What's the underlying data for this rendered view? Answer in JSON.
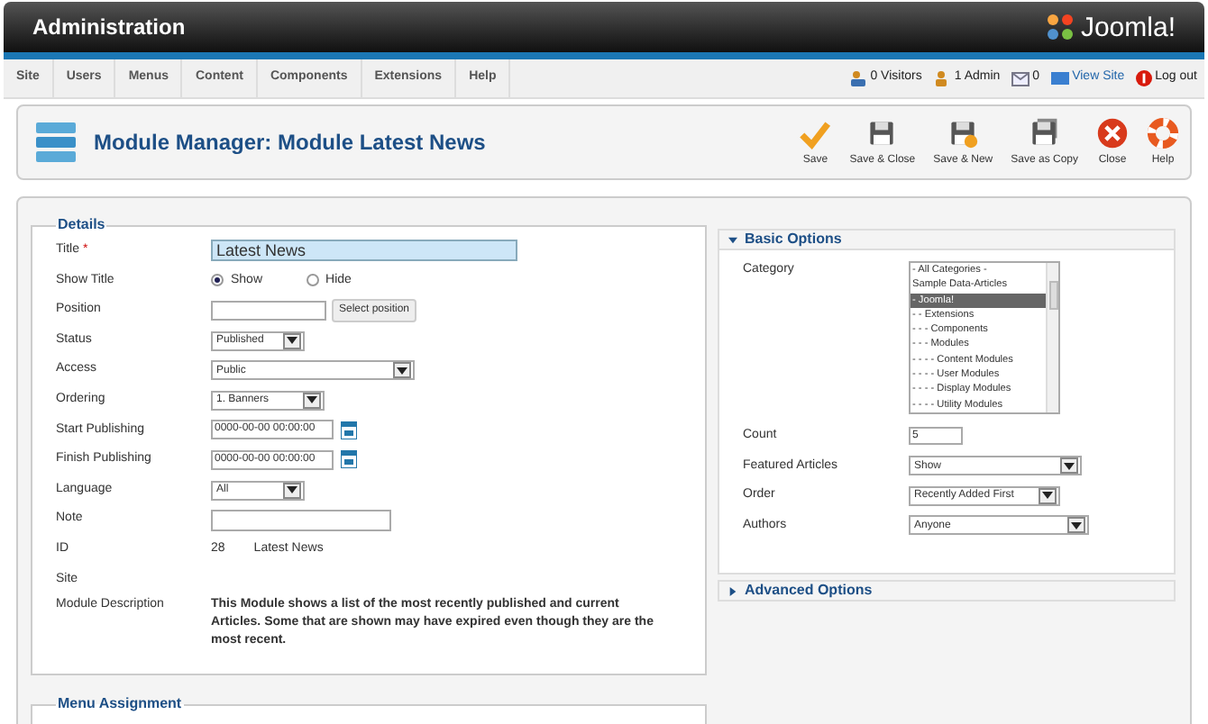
{
  "header": {
    "title": "Administration",
    "logo_text": "Joomla!"
  },
  "menu": [
    "Site",
    "Users",
    "Menus",
    "Content",
    "Components",
    "Extensions",
    "Help"
  ],
  "status": [
    {
      "kind": "visitors",
      "text": "0 Visitors"
    },
    {
      "kind": "admins",
      "text": "1 Admin"
    },
    {
      "kind": "messages",
      "text": "0"
    },
    {
      "kind": "view_site",
      "text": "View Site"
    },
    {
      "kind": "logout",
      "text": "Log out"
    }
  ],
  "toolbar": {
    "title": "Module Manager: Module Latest News",
    "buttons": [
      {
        "kind": "save",
        "label": "Save"
      },
      {
        "kind": "save_close",
        "label": "Save & Close"
      },
      {
        "kind": "save_new",
        "label": "Save & New"
      },
      {
        "kind": "save_copy",
        "label": "Save as Copy"
      },
      {
        "kind": "close",
        "label": "Close"
      },
      {
        "kind": "help",
        "label": "Help"
      }
    ]
  },
  "details": {
    "legend": "Details",
    "fields": [
      {
        "kind": "text",
        "label": "Title",
        "required": "*",
        "value": "Latest News",
        "focused": true
      },
      {
        "kind": "radio",
        "label": "Show Title",
        "options": [
          {
            "label": "Show",
            "selected": true
          },
          {
            "label": "Hide",
            "selected": false
          }
        ]
      },
      {
        "kind": "text_button",
        "label": "Position",
        "button": "Select position"
      },
      {
        "kind": "select",
        "label": "Status",
        "value": "Published"
      },
      {
        "kind": "select",
        "label": "Access",
        "value": "Public"
      },
      {
        "kind": "select",
        "label": "Ordering",
        "value": "1. Banners"
      },
      {
        "kind": "date",
        "label": "Start Publishing",
        "value": "0000-00-00 00:00:00"
      },
      {
        "kind": "date",
        "label": "Finish Publishing",
        "value": "0000-00-00 00:00:00"
      },
      {
        "kind": "select",
        "label": "Language",
        "value": "All"
      },
      {
        "kind": "text",
        "label": "Note",
        "focused": false
      },
      {
        "kind": "static",
        "label": "ID",
        "values": [
          "28",
          "Latest News"
        ]
      },
      {
        "kind": "static",
        "label": "Site"
      },
      {
        "kind": "description",
        "label": "Module Description",
        "text": "This Module shows a list of the most recently published and current Articles. Some that are shown may have expired even though they are the most recent."
      }
    ]
  },
  "menu_assignment": {
    "legend": "Menu Assignment"
  },
  "basic_options": {
    "title": "Basic Options",
    "expanded": true,
    "category": {
      "label": "Category",
      "items": [
        {
          "label": "- All Categories -",
          "selected": false
        },
        {
          "label": "Sample Data-Articles",
          "selected": false
        },
        {
          "label": "- Joomla!",
          "selected": true
        },
        {
          "label": "- - Extensions",
          "selected": false
        },
        {
          "label": "- - - Components",
          "selected": false
        },
        {
          "label": "- - - Modules",
          "selected": false
        },
        {
          "label": "- - - - Content Modules",
          "selected": false
        },
        {
          "label": "- - - - User Modules",
          "selected": false
        },
        {
          "label": "- - - - Display Modules",
          "selected": false
        },
        {
          "label": "- - - - Utility Modules",
          "selected": false
        }
      ]
    },
    "fields": [
      {
        "kind": "text",
        "label": "Count",
        "value": "5"
      },
      {
        "kind": "select",
        "label": "Featured Articles",
        "value": "Show"
      },
      {
        "kind": "select",
        "label": "Order",
        "value": "Recently Added First"
      },
      {
        "kind": "select",
        "label": "Authors",
        "value": "Anyone"
      }
    ]
  },
  "advanced_options": {
    "title": "Advanced Options",
    "expanded": false
  }
}
